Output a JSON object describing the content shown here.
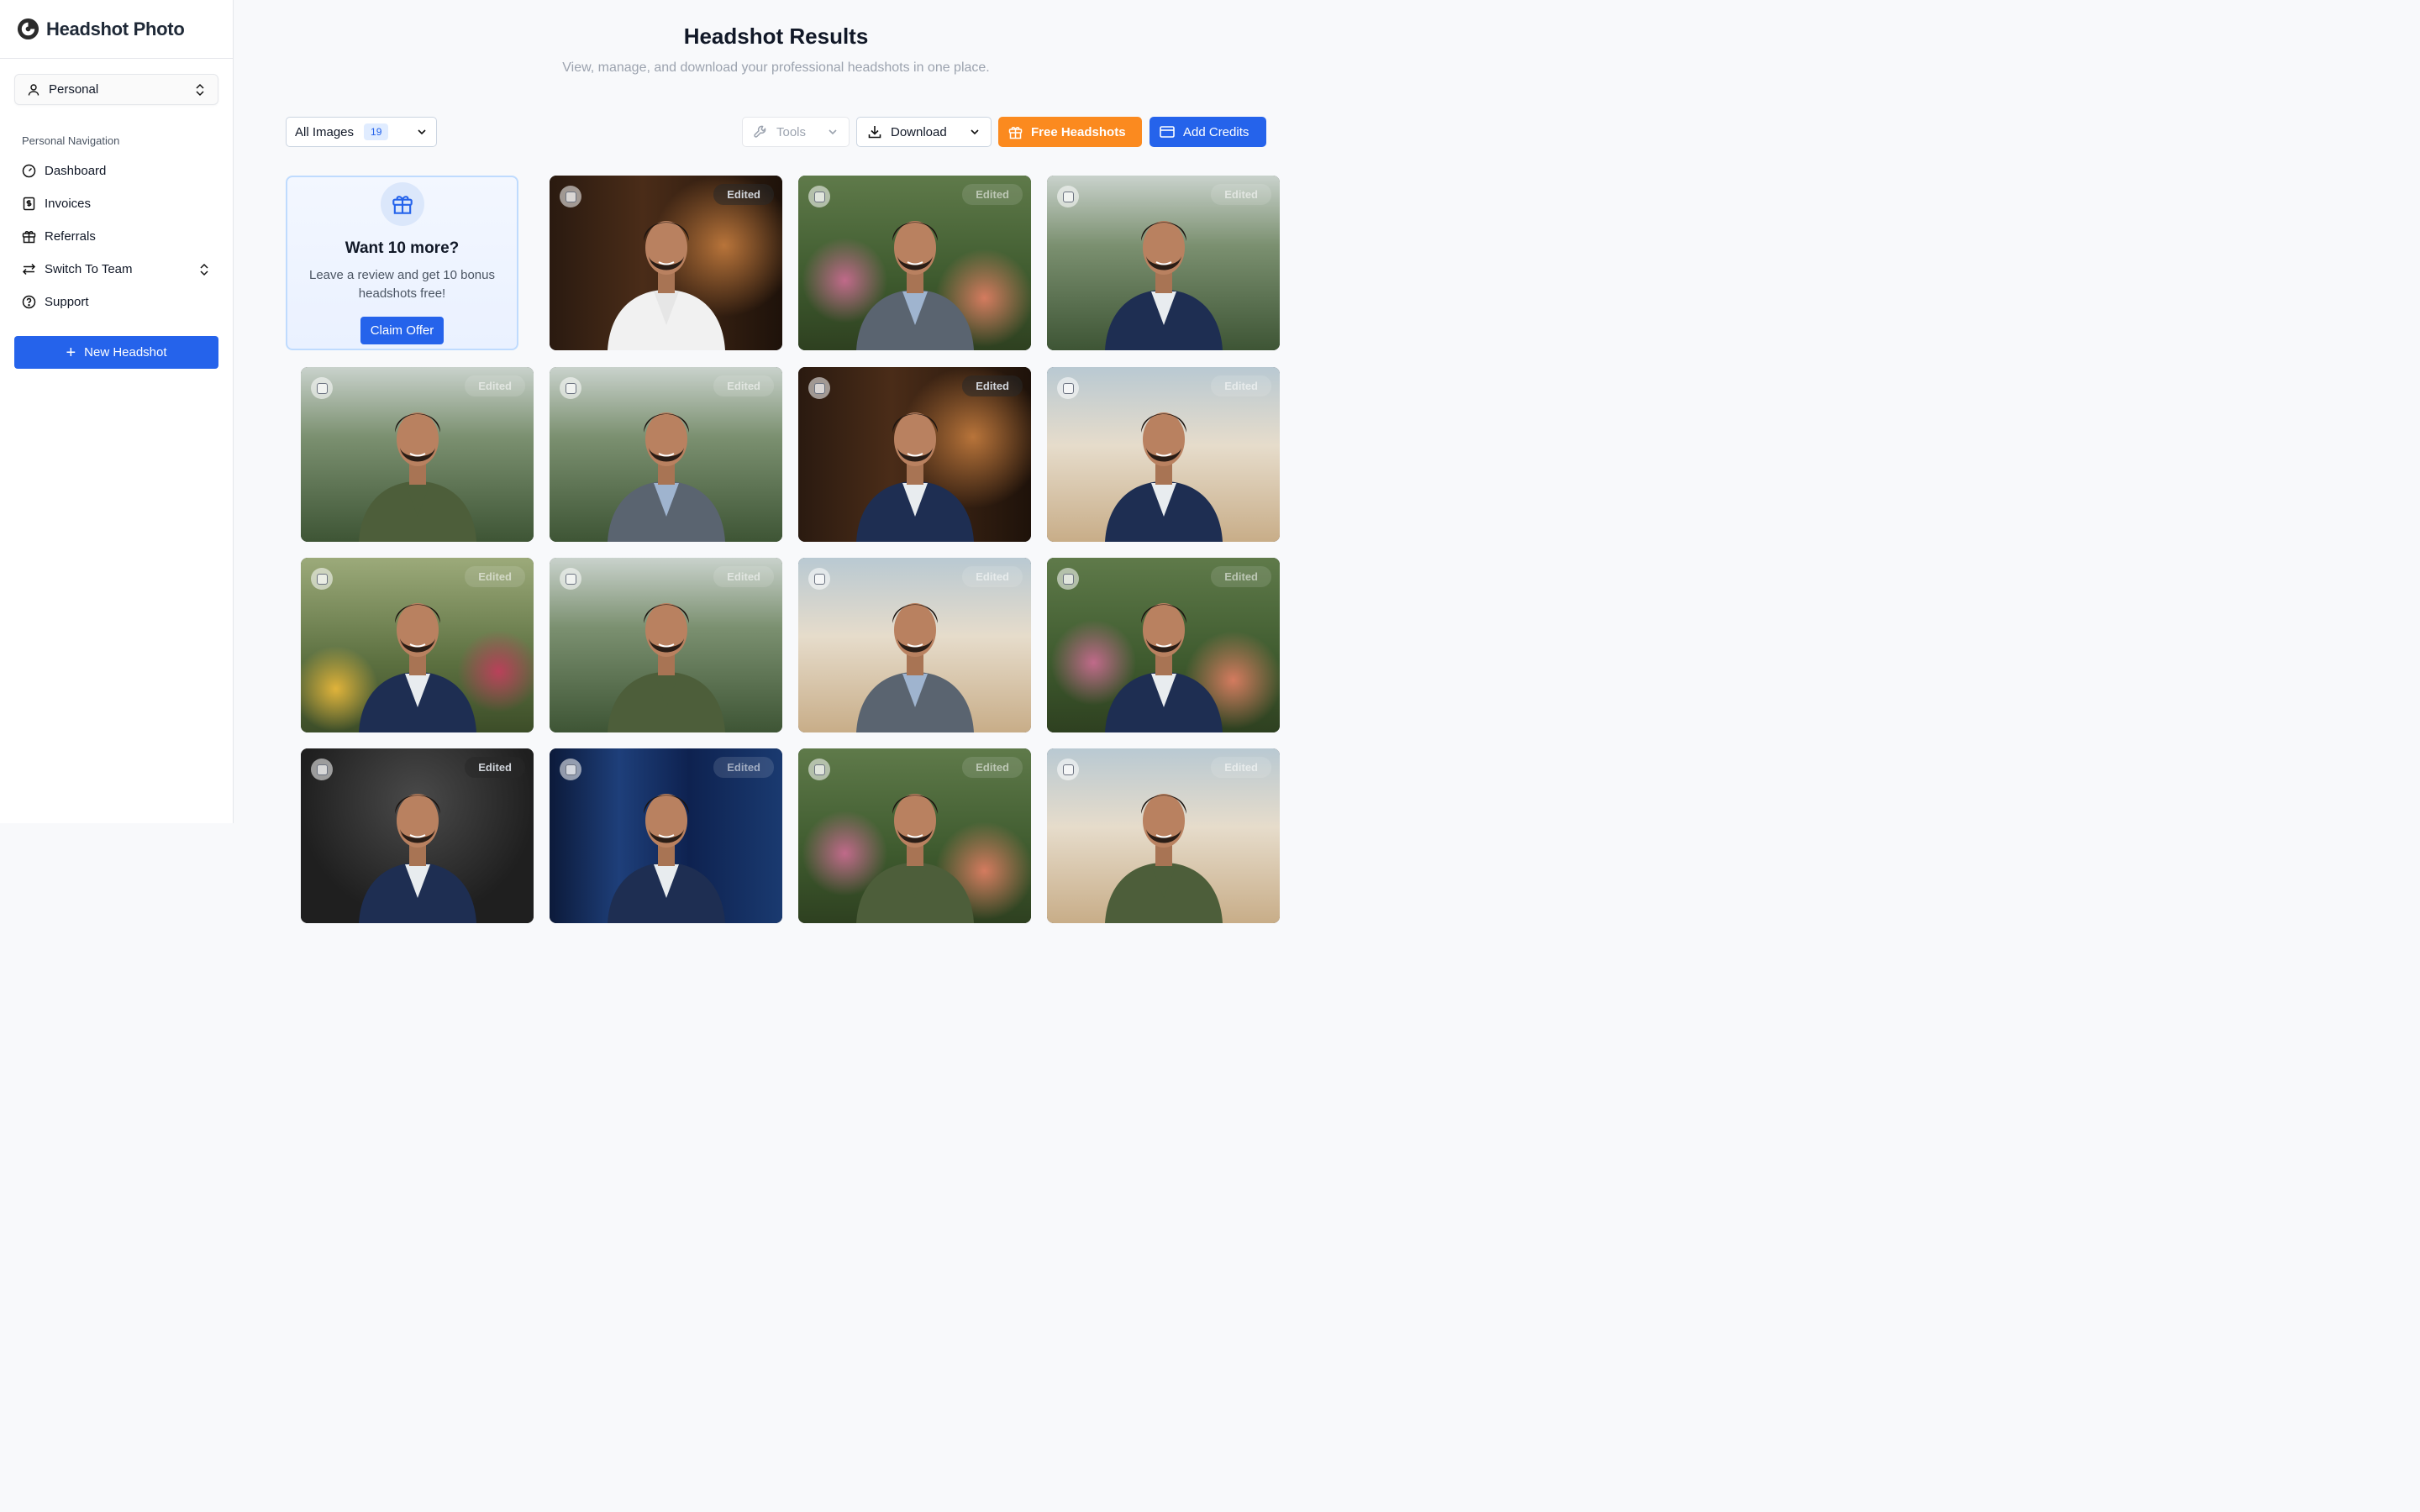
{
  "brand": {
    "name": "Headshot Photo"
  },
  "account": {
    "label": "Personal"
  },
  "sidebar": {
    "heading": "Personal Navigation",
    "items": [
      {
        "label": "Dashboard",
        "icon": "gauge-icon"
      },
      {
        "label": "Invoices",
        "icon": "invoice-icon"
      },
      {
        "label": "Referrals",
        "icon": "gift-icon"
      },
      {
        "label": "Switch To Team",
        "icon": "switch-icon"
      },
      {
        "label": "Support",
        "icon": "help-icon"
      }
    ],
    "new_button": "New Headshot"
  },
  "header": {
    "title": "Headshot Results",
    "subtitle": "View, manage, and download your professional headshots in one place."
  },
  "toolbar": {
    "filter_label": "All Images",
    "filter_count": "19",
    "tools_label": "Tools",
    "download_label": "Download",
    "free_label": "Free Headshots",
    "credits_label": "Add Credits"
  },
  "promo": {
    "title": "Want 10 more?",
    "body": "Leave a review and get 10 bonus headshots free!",
    "button": "Claim Offer"
  },
  "photos": [
    {
      "tag": "Edited",
      "scene": "bar",
      "outfit": "white-shirt"
    },
    {
      "tag": "Edited",
      "scene": "garden",
      "outfit": "gray-suit"
    },
    {
      "tag": "Edited",
      "scene": "greenhouse",
      "outfit": "navy-suit"
    },
    {
      "tag": "Edited",
      "scene": "greenhouse",
      "outfit": "green-shirt"
    },
    {
      "tag": "Edited",
      "scene": "greenhouse",
      "outfit": "gray-suit"
    },
    {
      "tag": "Edited",
      "scene": "bar",
      "outfit": "navy-suit"
    },
    {
      "tag": "Edited",
      "scene": "beach",
      "outfit": "navy-suit"
    },
    {
      "tag": "Edited",
      "scene": "meadow",
      "outfit": "navy-suit"
    },
    {
      "tag": "Edited",
      "scene": "greenhouse",
      "outfit": "green-shirt"
    },
    {
      "tag": "Edited",
      "scene": "beach",
      "outfit": "gray-suit"
    },
    {
      "tag": "Edited",
      "scene": "garden",
      "outfit": "navy-suit"
    },
    {
      "tag": "Edited",
      "scene": "studio",
      "outfit": "navy-suit"
    },
    {
      "tag": "Edited",
      "scene": "server",
      "outfit": "navy-suit"
    },
    {
      "tag": "Edited",
      "scene": "garden",
      "outfit": "green-shirt"
    },
    {
      "tag": "Edited",
      "scene": "beach",
      "outfit": "green-shirt"
    }
  ],
  "colors": {
    "accent": "#2563eb",
    "orange": "#fb8a1f"
  }
}
